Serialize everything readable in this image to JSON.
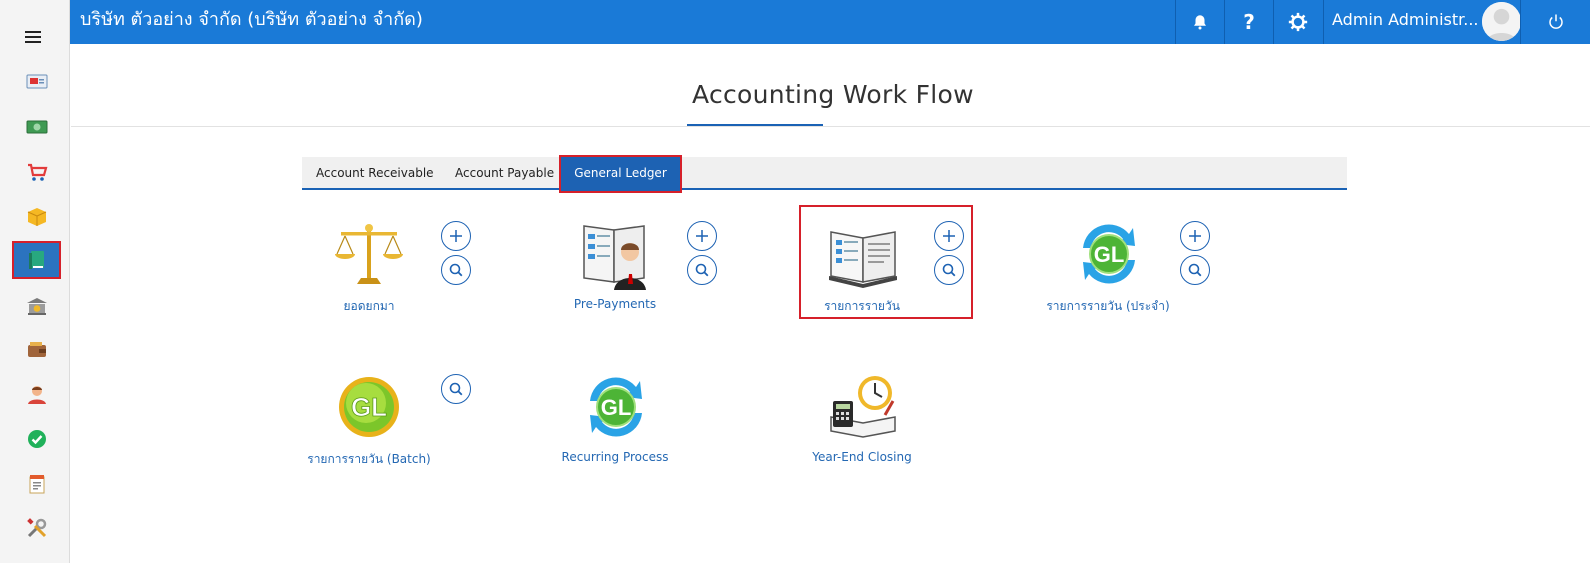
{
  "topbar": {
    "company": "บริษัท ตัวอย่าง จำกัด (บริษัท ตัวอย่าง จำกัด)",
    "user_name": "Admin Administr...",
    "help_label": "?"
  },
  "page": {
    "title": "Accounting Work Flow"
  },
  "tabs": [
    {
      "label": "Account Receivable"
    },
    {
      "label": "Account Payable"
    },
    {
      "label": "General Ledger"
    }
  ],
  "items": [
    {
      "label": "ยอดยกมา",
      "icon": "scales-icon"
    },
    {
      "label": "Pre-Payments",
      "icon": "ledger-person-icon"
    },
    {
      "label": "รายการรายวัน",
      "icon": "open-book-icon"
    },
    {
      "label": "รายการรายวัน (ประจำ)",
      "icon": "gl-recurring-icon"
    },
    {
      "label": "รายการรายวัน (Batch)",
      "icon": "gl-batch-icon"
    },
    {
      "label": "Recurring Process",
      "icon": "gl-process-icon"
    },
    {
      "label": "Year-End Closing",
      "icon": "year-end-icon"
    }
  ],
  "colors": {
    "topbar": "#1a7ad7",
    "accent": "#1d62b3",
    "highlight": "#d6202a",
    "link": "#2468b3"
  }
}
